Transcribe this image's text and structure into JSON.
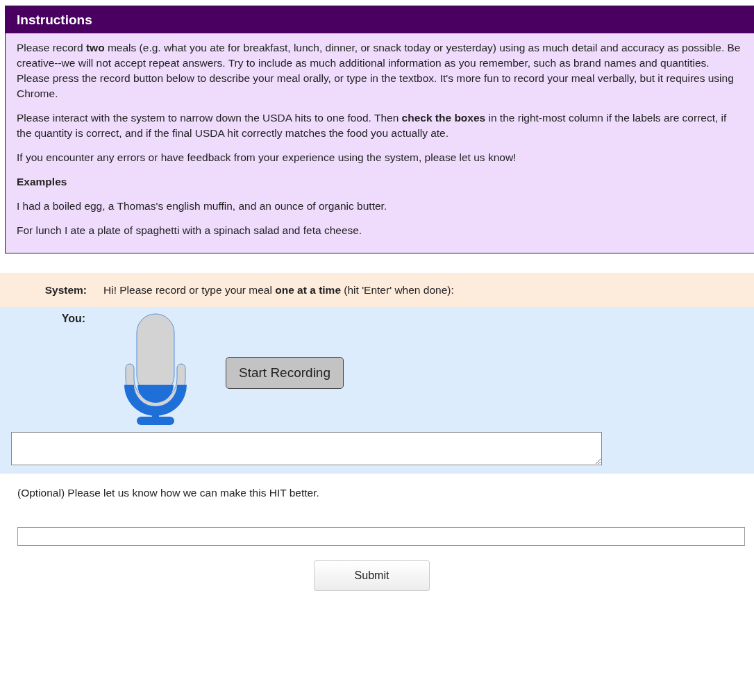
{
  "instructions": {
    "title": "Instructions",
    "paragraphs": [
      "Please record **two** meals (e.g. what you ate for breakfast, lunch, dinner, or snack today or yesterday) using as much detail and accuracy as possible. Be creative--we will not accept repeat answers. Try to include as much additional information as you remember, such as brand names and quantities. Please press the record button below to describe your meal orally, or type in the textbox. It's more fun to record your meal verbally, but it requires using Chrome.",
      "Please interact with the system to narrow down the USDA hits to one food. Then **check the boxes** in the right-most column if the labels are correct, if the quantity is correct, and if the final USDA hit correctly matches the food you actually ate.",
      "If you encounter any errors or have feedback from your experience using the system, please let us know!"
    ],
    "examples_heading": "Examples",
    "examples": [
      "I had a boiled egg, a Thomas's english muffin, and an ounce of organic butter.",
      "For lunch I ate a plate of spaghetti with a spinach salad and feta cheese."
    ]
  },
  "dialog": {
    "system_label": "System:",
    "system_message": "Hi! Please record or type your meal **one at a time** (hit 'Enter' when done):",
    "you_label": "You:",
    "record_button": "Start Recording"
  },
  "feedback": {
    "prompt": "(Optional) Please let us know how we can make this HIT better.",
    "submit_button": "Submit"
  }
}
